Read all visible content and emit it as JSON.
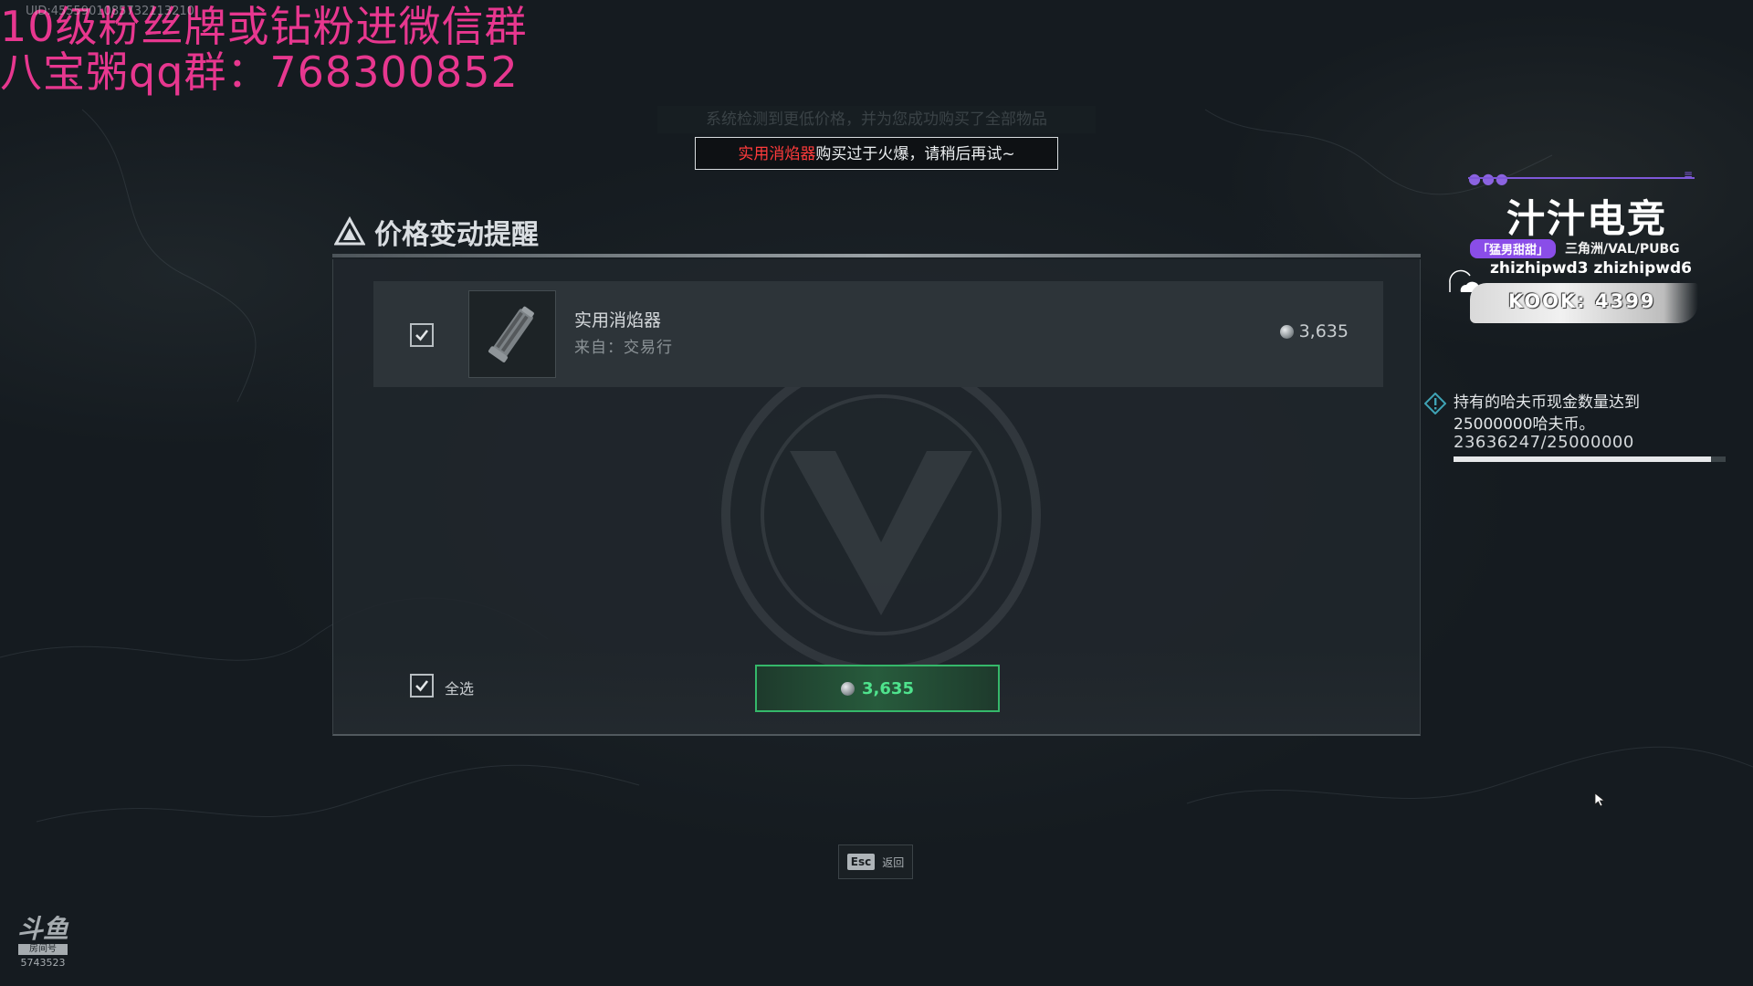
{
  "stream_overlay": {
    "tiny_id": "UID:4555901085732113210",
    "line1": "10级粉丝牌或钻粉进微信群",
    "line2": "八宝粥qq群：768300852"
  },
  "system_notice": {
    "ghost_text": "系统检测到更低价格，并为您成功购买了全部物品",
    "toast_item": "实用消焰器",
    "toast_message": "购买过于火爆，请稍后再试~"
  },
  "dialog": {
    "title": "价格变动提醒",
    "item": {
      "checked": true,
      "name": "实用消焰器",
      "source": "来自：交易行",
      "price": "3,635"
    },
    "select_all_label": "全选",
    "select_all_checked": true,
    "buy_price": "3,635"
  },
  "esc": {
    "key": "Esc",
    "label": "返回"
  },
  "streamer_panel": {
    "name": "汁汁电竞",
    "tag": "「猛男甜甜」",
    "games": "三角洲/VAL/PUBG",
    "ids": "zhizhipwd3  zhizhipwd6",
    "kook": "KOOK: 4399"
  },
  "achievement": {
    "line1": "持有的哈夫币现金数量达到",
    "line2": "25000000哈夫币。",
    "progress_text": "23636247/25000000",
    "progress_fraction": 0.945
  },
  "douyu": {
    "room_label": "房间号",
    "room_number": "5743523"
  },
  "colors": {
    "overlay_pink": "#e7378f",
    "toast_red": "#ff3b3b",
    "buy_green": "#35b86a",
    "purple_accent": "#8a4de8"
  }
}
